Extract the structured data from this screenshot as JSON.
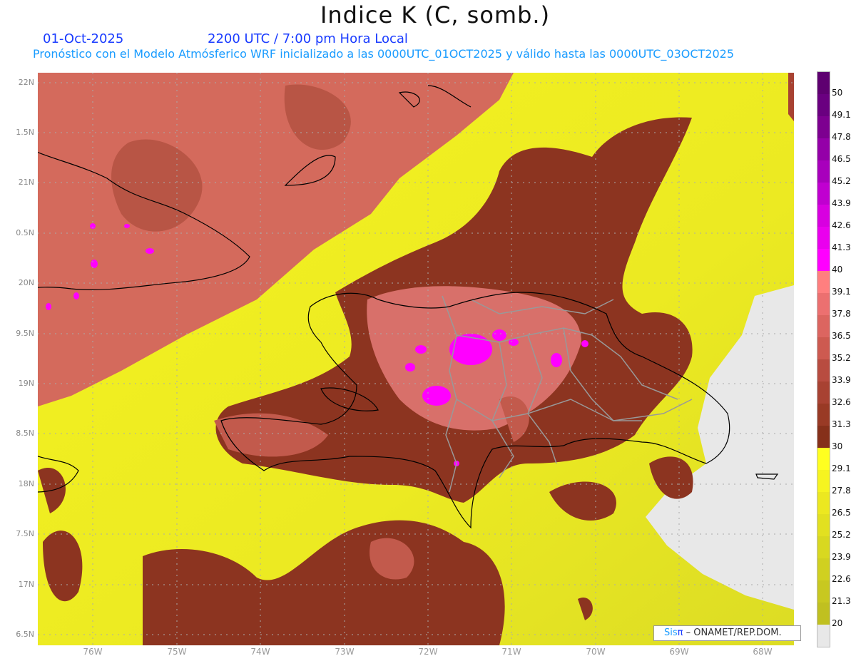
{
  "header": {
    "title": "Indice K (C, somb.)",
    "date": "01-Oct-2025",
    "time": "2200 UTC / 7:00 pm Hora Local",
    "subtitle": "Pronóstico con el Modelo Atmósferico WRF inicializado a las 0000UTC_01OCT2025 y válido hasta las  0000UTC_03OCT2025"
  },
  "axes": {
    "lat_labels": [
      "22N",
      "1.5N",
      "21N",
      "0.5N",
      "20N",
      "9.5N",
      "19N",
      "8.5N",
      "18N",
      "7.5N",
      "17N",
      "6.5N"
    ],
    "lon_labels": [
      "76W",
      "75W",
      "74W",
      "73W",
      "72W",
      "71W",
      "70W",
      "69W",
      "68W"
    ]
  },
  "colorbar": {
    "labels": [
      "50",
      "49.1",
      "47.8",
      "46.5",
      "45.2",
      "43.9",
      "42.6",
      "41.3",
      "40",
      "39.1",
      "37.8",
      "36.5",
      "35.2",
      "33.9",
      "32.6",
      "31.3",
      "30",
      "29.1",
      "27.8",
      "26.5",
      "25.2",
      "23.9",
      "22.6",
      "21.3",
      "20"
    ],
    "colors": [
      "#5e0070",
      "#6a0080",
      "#7d0090",
      "#9400a8",
      "#a800bc",
      "#c000d0",
      "#d800e0",
      "#ea00ee",
      "#ff00ff",
      "#ff7f7f",
      "#ec7070",
      "#dc6560",
      "#cd5a50",
      "#b84c40",
      "#a84232",
      "#993a25",
      "#86301a",
      "#ffff20",
      "#f6f420",
      "#ece820",
      "#e2e020",
      "#d8d820",
      "#d0d020",
      "#c8c820",
      "#c0c020",
      "#e8e8e8"
    ]
  },
  "credit": {
    "brand": "Sis",
    "pi": "π",
    "org": " –  ONAMET/REP.DOM."
  }
}
